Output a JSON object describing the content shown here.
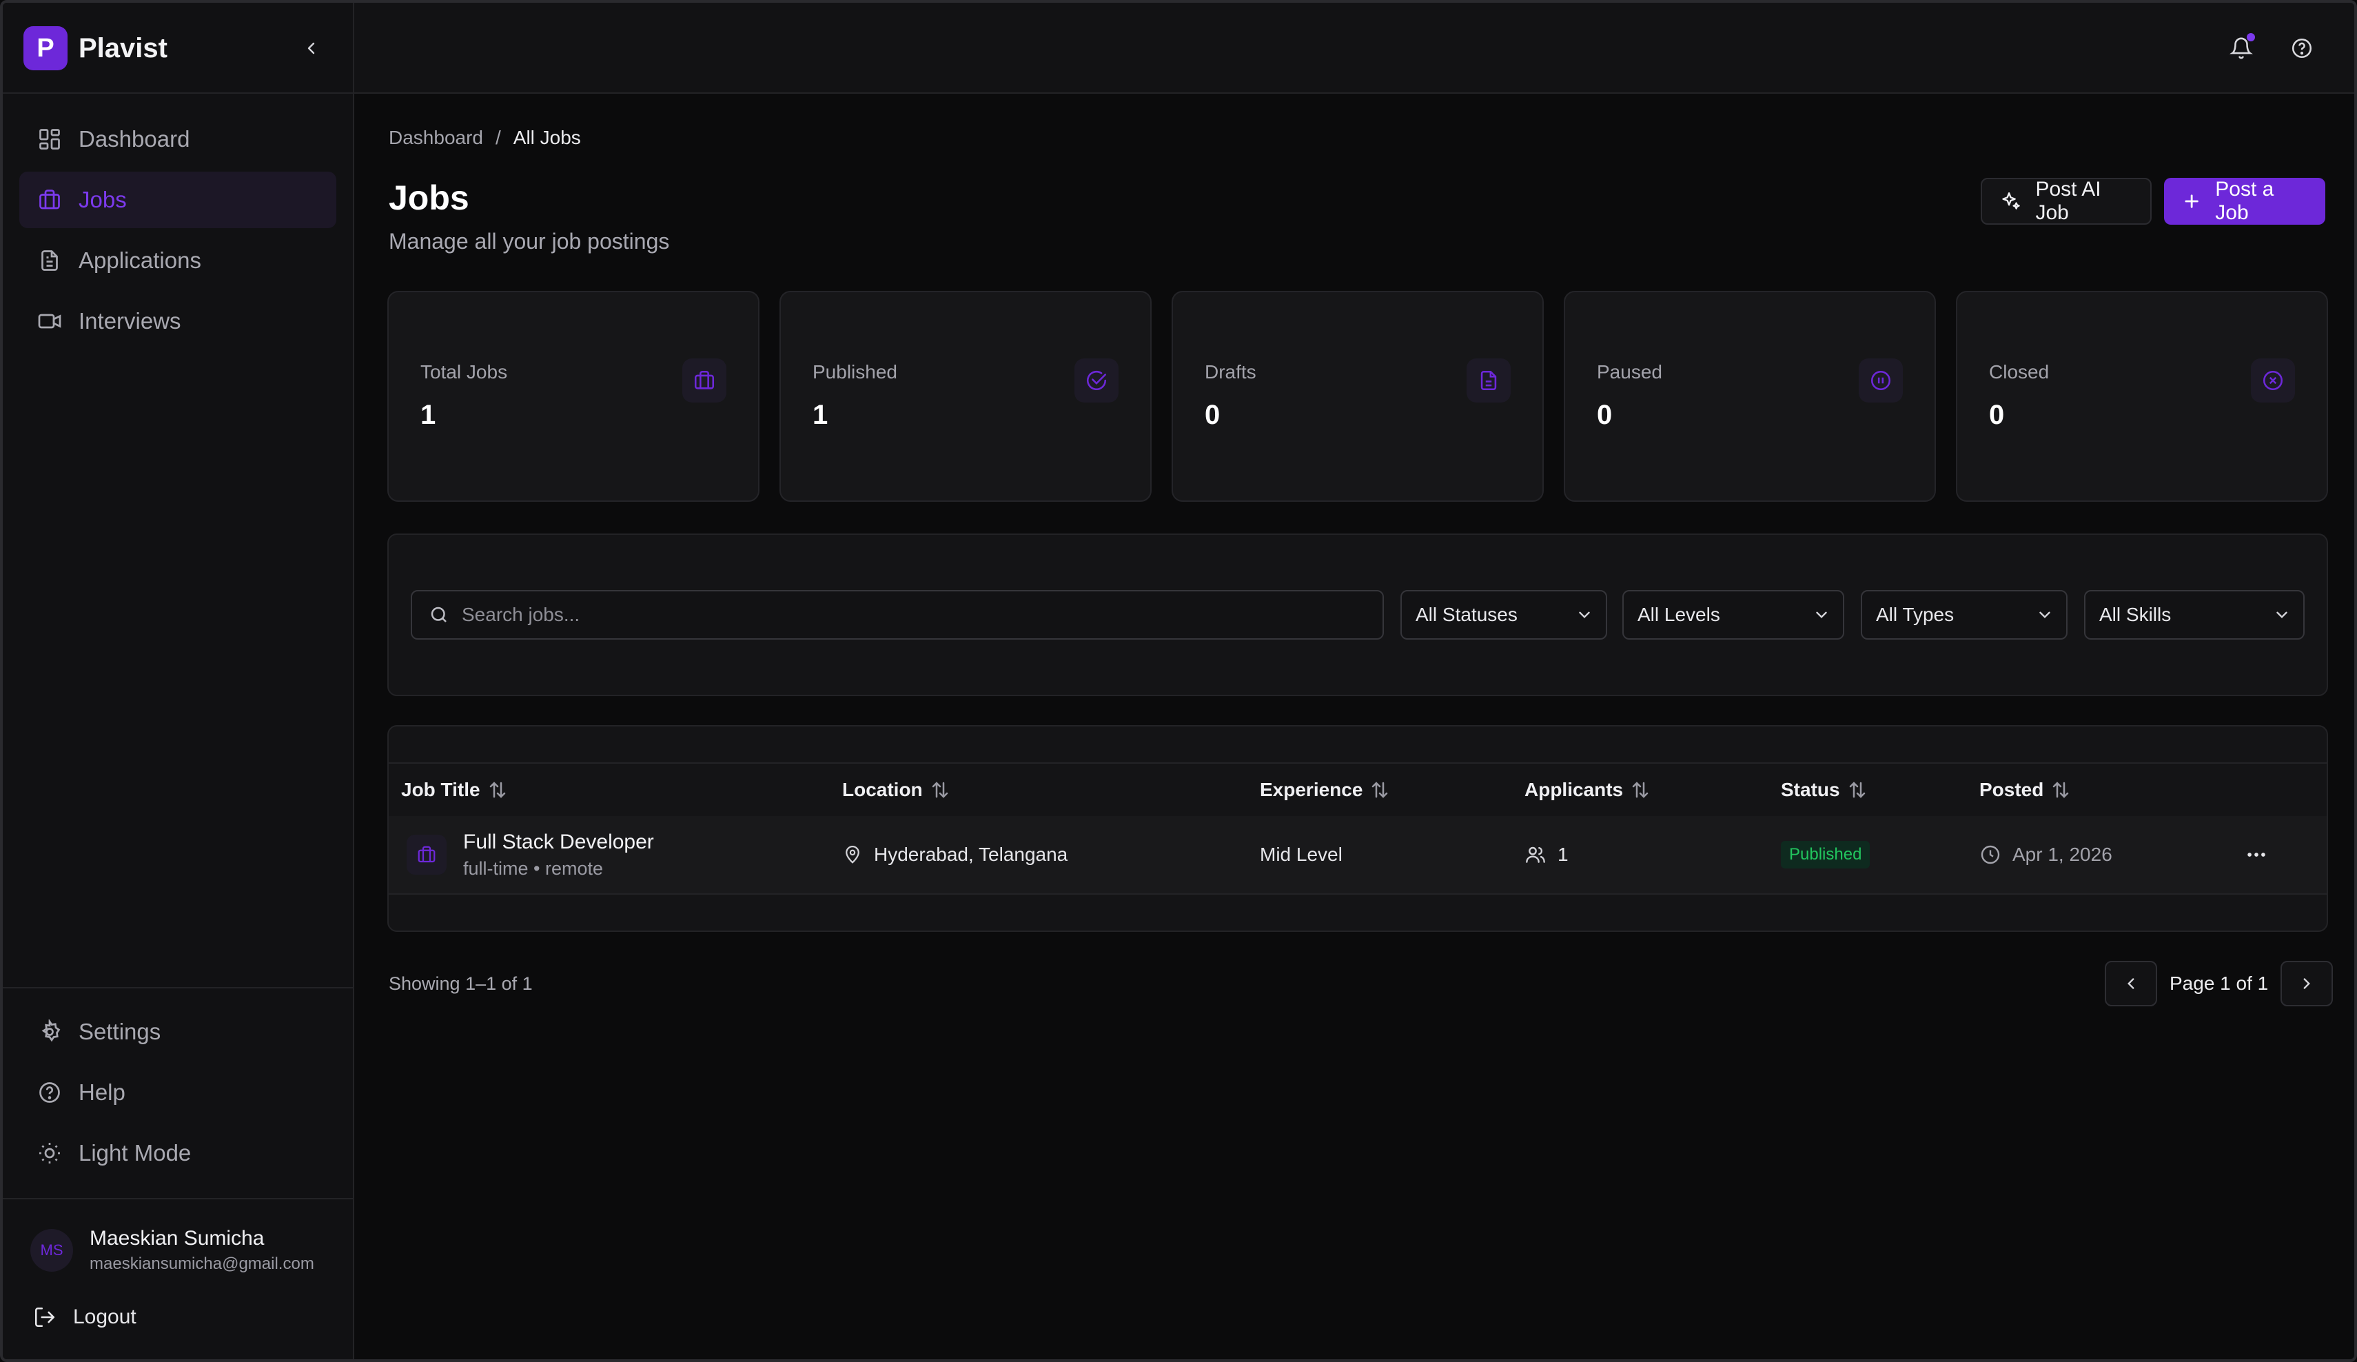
{
  "app": {
    "logo_letter": "P",
    "name": "Plavist"
  },
  "sidebar": {
    "items": [
      {
        "label": "Dashboard",
        "icon": "dashboard-icon"
      },
      {
        "label": "Jobs",
        "icon": "briefcase-icon",
        "active": true
      },
      {
        "label": "Applications",
        "icon": "document-icon"
      },
      {
        "label": "Interviews",
        "icon": "video-icon"
      }
    ],
    "bottom_items": [
      {
        "label": "Settings",
        "icon": "gear-icon"
      },
      {
        "label": "Help",
        "icon": "help-icon"
      },
      {
        "label": "Light Mode",
        "icon": "sun-icon"
      }
    ],
    "user": {
      "initials": "MS",
      "name": "Maeskian Sumicha",
      "email": "maeskiansumicha@gmail.com"
    },
    "logout_label": "Logout"
  },
  "breadcrumb": {
    "root": "Dashboard",
    "separator": "/",
    "current": "All Jobs"
  },
  "page": {
    "title": "Jobs",
    "subtitle": "Manage all your job postings"
  },
  "actions": {
    "post_ai_label": "Post AI Job",
    "post_job_label": "Post a Job"
  },
  "stats": [
    {
      "label": "Total Jobs",
      "value": "1",
      "icon": "briefcase-icon"
    },
    {
      "label": "Published",
      "value": "1",
      "icon": "check-circle-icon"
    },
    {
      "label": "Drafts",
      "value": "0",
      "icon": "document-icon"
    },
    {
      "label": "Paused",
      "value": "0",
      "icon": "pause-circle-icon"
    },
    {
      "label": "Closed",
      "value": "0",
      "icon": "x-circle-icon"
    }
  ],
  "filters": {
    "search_placeholder": "Search jobs...",
    "status": "All Statuses",
    "level": "All Levels",
    "type": "All Types",
    "skills": "All Skills"
  },
  "table": {
    "columns": [
      "Job Title",
      "Location",
      "Experience",
      "Applicants",
      "Status",
      "Posted"
    ],
    "rows": [
      {
        "title": "Full Stack Developer",
        "subtitle": "full-time • remote",
        "location": "Hyderabad, Telangana",
        "experience": "Mid Level",
        "applicants": "1",
        "status": "Published",
        "posted": "Apr 1, 2026"
      }
    ]
  },
  "footer": {
    "showing": "Showing 1–1 of 1",
    "page_label": "Page 1 of 1"
  },
  "colors": {
    "accent": "#6d28d9",
    "accent_text": "#7c3aed",
    "success": "#22c55e"
  }
}
